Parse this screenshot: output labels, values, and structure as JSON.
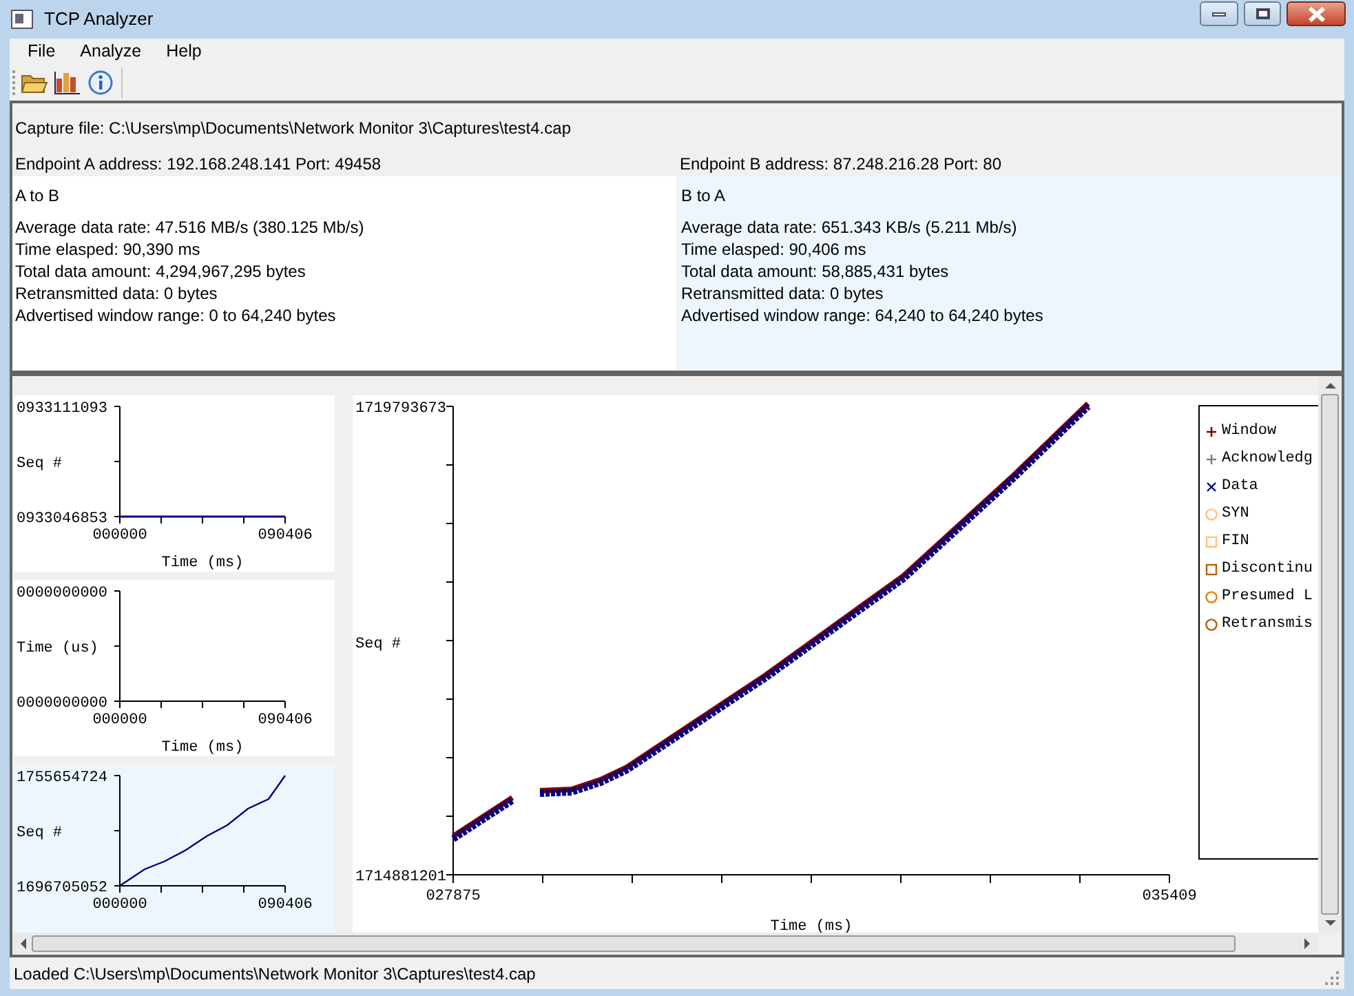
{
  "window": {
    "title": "TCP Analyzer"
  },
  "menu": [
    "File",
    "Analyze",
    "Help"
  ],
  "capture_file": "Capture file: C:\\Users\\mp\\Documents\\Network Monitor 3\\Captures\\test4.cap",
  "endpoints": [
    {
      "address": "Endpoint A address: 192.168.248.141 Port: 49458",
      "direction": "A to B",
      "selected": false,
      "stats": [
        "Average data rate: 47.516 MB/s (380.125 Mb/s)",
        "Time elasped: 90,390 ms",
        "Total data amount: 4,294,967,295 bytes",
        "Retransmitted data: 0 bytes",
        "Advertised window range: 0 to 64,240 bytes"
      ]
    },
    {
      "address": "Endpoint B address: 87.248.216.28 Port: 80",
      "direction": "B to A",
      "selected": true,
      "stats": [
        "Average data rate: 651.343 KB/s (5.211 Mb/s)",
        "Time elasped: 90,406 ms",
        "Total data amount: 58,885,431 bytes",
        "Retransmitted data: 0 bytes",
        "Advertised window range: 64,240 to 64,240 bytes"
      ]
    }
  ],
  "small_graphs": [
    {
      "y_max": "0933111093",
      "ylabel": "Seq #",
      "y_min": "0933046853",
      "x_min": "000000",
      "x_max": "090406",
      "xlabel": "Time (ms)",
      "kind": "flat",
      "selected": false
    },
    {
      "y_max": "0000000000",
      "ylabel": "Time (us)",
      "y_min": "0000000000",
      "x_min": "000000",
      "x_max": "090406",
      "xlabel": "Time (ms)",
      "kind": "empty",
      "selected": false
    },
    {
      "y_max": "1755654724",
      "ylabel": "Seq #",
      "y_min": "1696705052",
      "x_min": "000000",
      "x_max": "090406",
      "kind": "rising",
      "selected": true
    }
  ],
  "main_graph": {
    "y_max": "1719793673",
    "ylabel": "Seq #",
    "y_min": "1714881201",
    "x_min": "027875",
    "x_max": "035409",
    "xlabel": "Time (ms)"
  },
  "legend": [
    {
      "label": "Window",
      "kind": "plus",
      "color": "#800000"
    },
    {
      "label": "Acknowledg",
      "kind": "plus",
      "color": "#808080"
    },
    {
      "label": "Data",
      "kind": "cross",
      "color": "#000080"
    },
    {
      "label": "SYN",
      "kind": "circle",
      "color": "#ffc080"
    },
    {
      "label": "FIN",
      "kind": "square",
      "color": "#ffc080"
    },
    {
      "label": "Discontinu",
      "kind": "square",
      "color": "#c06000"
    },
    {
      "label": "Presumed L",
      "kind": "circle",
      "color": "#e08000"
    },
    {
      "label": "Retransmis",
      "kind": "circle",
      "color": "#b06000"
    }
  ],
  "status_bar": "Loaded C:\\Users\\mp\\Documents\\Network Monitor 3\\Captures\\test4.cap"
}
